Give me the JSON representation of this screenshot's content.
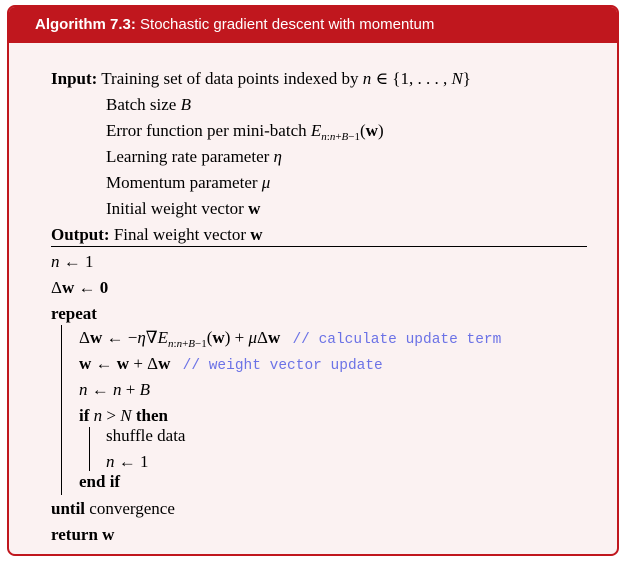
{
  "header": {
    "label": "Algorithm 7.3:",
    "title": "Stochastic gradient descent with momentum"
  },
  "input": {
    "keyword": "Input:",
    "training_set": "Training set of data points indexed by",
    "batch_size": "Batch size",
    "error_fn": "Error function per mini-batch",
    "learning_rate": "Learning rate parameter",
    "momentum": "Momentum parameter",
    "initial_weight": "Initial weight vector"
  },
  "output": {
    "keyword": "Output:",
    "final_weight": "Final weight vector"
  },
  "algorithm": {
    "repeat": "repeat",
    "if": "if",
    "then": "then",
    "shuffle": "shuffle data",
    "end_if": "end if",
    "until": "until",
    "convergence": "convergence",
    "return": "return",
    "comment_update_term": "// calculate update term",
    "comment_weight_update": "// weight vector update"
  },
  "colors": {
    "frame": "#c0171e",
    "background": "#fbf2f2",
    "comment": "#6b72e6"
  }
}
